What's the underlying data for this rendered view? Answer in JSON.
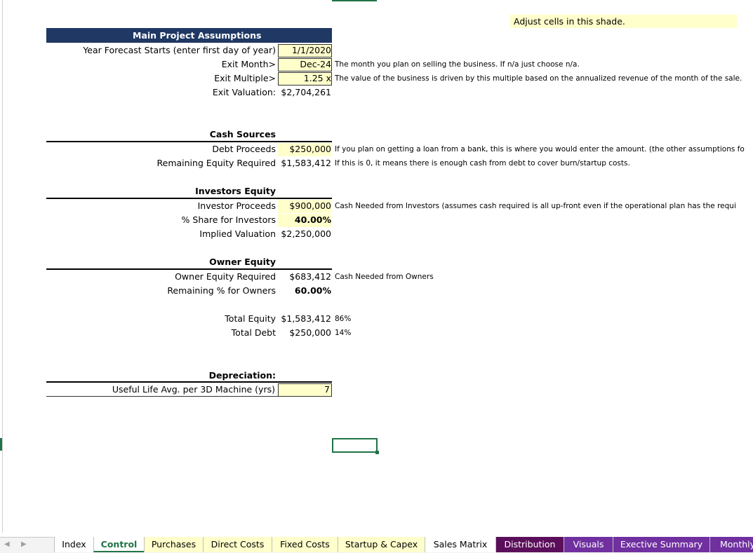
{
  "note_shade": "Adjust cells in this shade.",
  "main": {
    "title": "Main Project Assumptions",
    "rows": [
      {
        "label": "Year Forecast Starts (enter first day of year)",
        "value": "1/1/2020",
        "note": ""
      },
      {
        "label": "Exit Month>",
        "value": "Dec-24",
        "note": "The month you plan on selling the business. If n/a just choose n/a."
      },
      {
        "label": "Exit Multiple>",
        "value": "1.25 x",
        "note": "The value of the business is driven by this multiple based on the annualized revenue of the month of the sale."
      },
      {
        "label": "Exit Valuation:",
        "value": "$2,704,261",
        "note": ""
      }
    ]
  },
  "cash": {
    "title": "Cash Sources",
    "rows": [
      {
        "label": "Debt Proceeds",
        "value": "$250,000",
        "note": "If you plan on getting a loan from a bank, this is where you would enter the amount. (the other assumptions fo"
      },
      {
        "label": "Remaining Equity Required",
        "value": "$1,583,412",
        "note": "If this is 0, it means there is enough cash from debt to cover burn/startup costs."
      }
    ]
  },
  "investors": {
    "title": "Investors Equity",
    "rows": [
      {
        "label": "Investor Proceeds",
        "value": "$900,000",
        "note": "Cash Needed from Investors (assumes cash required is all up-front even if the operational plan has the requi"
      },
      {
        "label": "% Share for Investors",
        "value": "40.00%",
        "note": ""
      },
      {
        "label": "Implied Valuation",
        "value": "$2,250,000",
        "note": ""
      }
    ]
  },
  "owner": {
    "title": "Owner Equity",
    "rows": [
      {
        "label": "Owner Equity Required",
        "value": "$683,412",
        "note": "Cash Needed from Owners"
      },
      {
        "label": "Remaining % for Owners",
        "value": "60.00%",
        "note": ""
      }
    ]
  },
  "totals": {
    "rows": [
      {
        "label": "Total Equity",
        "value": "$1,583,412",
        "pct": "86%"
      },
      {
        "label": "Total Debt",
        "value": "$250,000",
        "pct": "14%"
      }
    ]
  },
  "depreciation": {
    "title": "Depreciation:",
    "label": "Useful Life Avg. per 3D Machine (yrs)",
    "value": "7"
  },
  "tabs": [
    {
      "label": "Index"
    },
    {
      "label": "Control"
    },
    {
      "label": "Purchases"
    },
    {
      "label": "Direct Costs"
    },
    {
      "label": "Fixed Costs"
    },
    {
      "label": "Startup & Capex"
    },
    {
      "label": "Sales Matrix"
    },
    {
      "label": "Distribution"
    },
    {
      "label": "Visuals"
    },
    {
      "label": "Exective Summary"
    },
    {
      "label": "Monthly"
    }
  ],
  "colors": {
    "header_navy": "#1f3864",
    "input_shade": "#ffffcc",
    "tab_active_text": "#217346",
    "tab_purple": "#7030a0",
    "tab_darkpurple": "#5b0f5b"
  }
}
